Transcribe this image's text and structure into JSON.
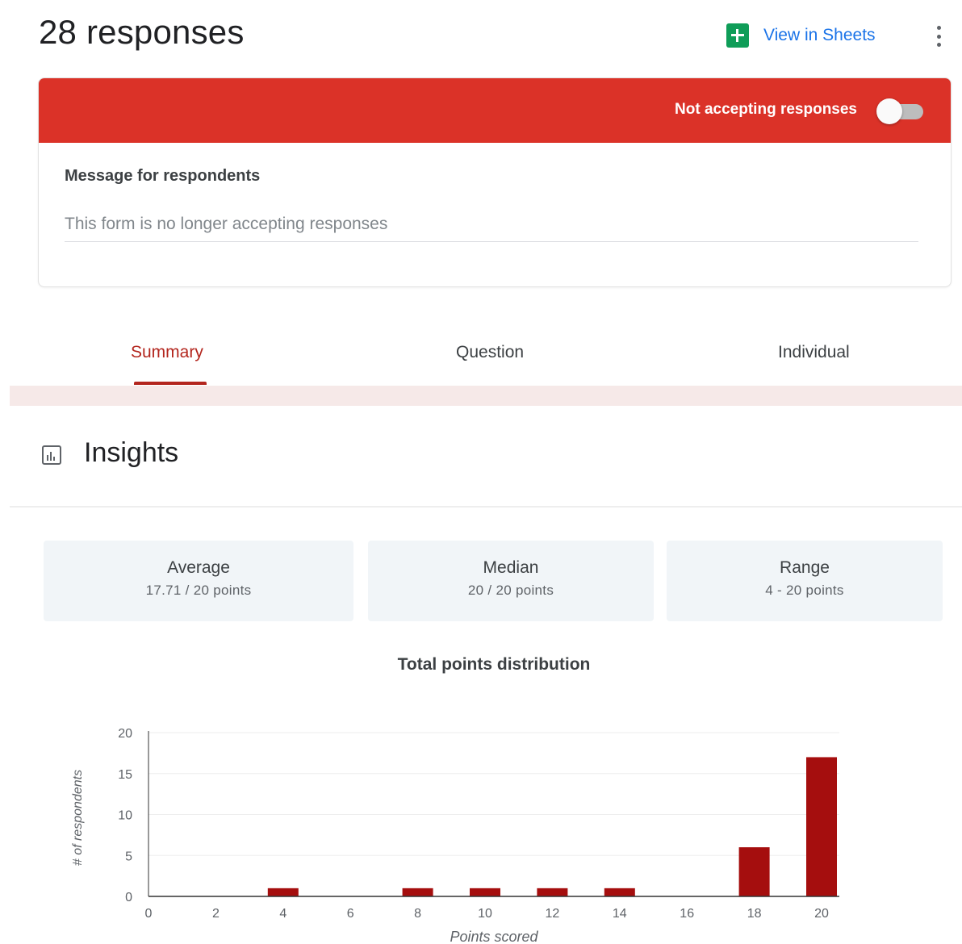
{
  "header": {
    "title": "28 responses",
    "sheets_label": "View in Sheets",
    "sheets_icon": "google-sheets-icon",
    "menu_icon": "more-vert-icon"
  },
  "status_card": {
    "banner_text": "Not accepting responses",
    "banner_color": "#db3228",
    "accepting_toggle_on": false,
    "message_label": "Message for respondents",
    "message_value": "This form is no longer accepting responses"
  },
  "tabs": [
    {
      "label": "Summary",
      "active": true
    },
    {
      "label": "Question",
      "active": false
    },
    {
      "label": "Individual",
      "active": false
    }
  ],
  "insights": {
    "title": "Insights",
    "icon": "insights-chart-icon",
    "stats": [
      {
        "label": "Average",
        "value": "17.71 / 20 points"
      },
      {
        "label": "Median",
        "value": "20 / 20 points"
      },
      {
        "label": "Range",
        "value": "4 - 20 points"
      }
    ]
  },
  "chart_data": {
    "type": "bar",
    "title": "Total points distribution",
    "xlabel": "Points scored",
    "ylabel": "# of respondents",
    "x_ticks": [
      "0",
      "2",
      "4",
      "6",
      "8",
      "10",
      "12",
      "14",
      "16",
      "18",
      "20"
    ],
    "y_ticks": [
      "0",
      "5",
      "10",
      "15",
      "20"
    ],
    "xlim": [
      0,
      20
    ],
    "ylim": [
      0,
      20
    ],
    "bar_color": "#a50e0e",
    "bars": [
      {
        "x": 4,
        "value": 1
      },
      {
        "x": 8,
        "value": 1
      },
      {
        "x": 10,
        "value": 1
      },
      {
        "x": 12,
        "value": 1
      },
      {
        "x": 14,
        "value": 1
      },
      {
        "x": 18,
        "value": 6
      },
      {
        "x": 20,
        "value": 17
      }
    ]
  }
}
